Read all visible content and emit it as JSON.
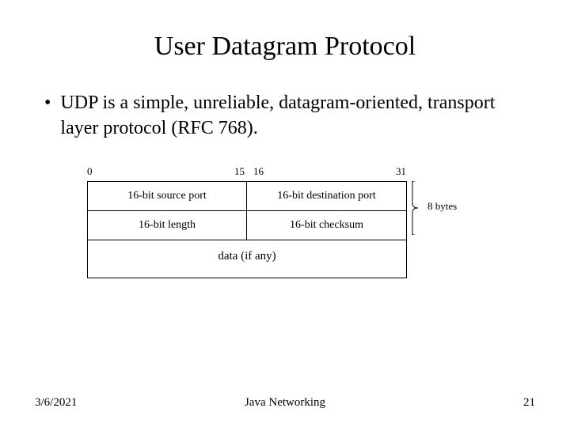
{
  "title": "User Datagram Protocol",
  "bullet": "UDP is a simple, unreliable, datagram-oriented, transport layer protocol (RFC 768).",
  "ruler": {
    "b0": "0",
    "b15": "15",
    "b16": "16",
    "b31": "31"
  },
  "header": {
    "row1": {
      "left": "16-bit source port",
      "right": "16-bit destination port"
    },
    "row2": {
      "left": "16-bit length",
      "right": "16-bit checksum"
    }
  },
  "data_label": "data (if any)",
  "brace_label": "8 bytes",
  "footer": {
    "date": "3/6/2021",
    "center": "Java Networking",
    "page": "21"
  }
}
